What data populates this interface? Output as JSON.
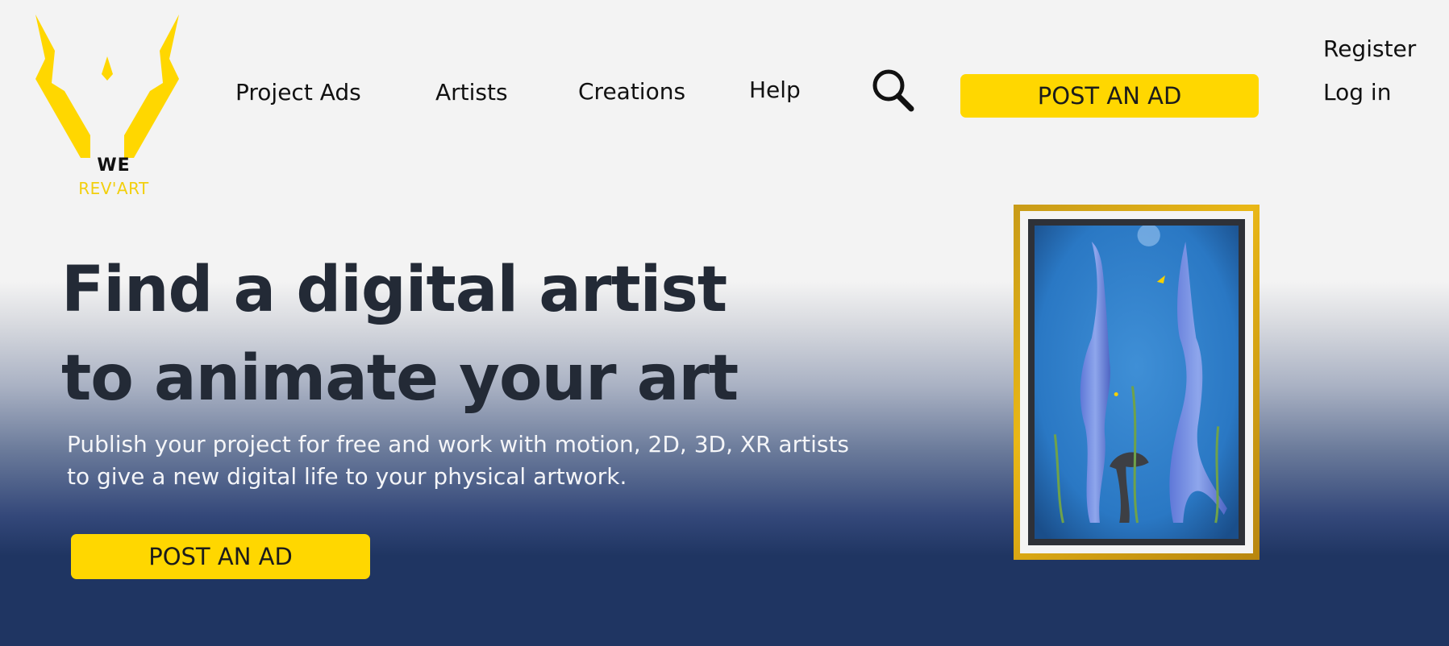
{
  "logo": {
    "we": "WE",
    "revart": "REV'ART",
    "brand_color": "#ffd700"
  },
  "nav": {
    "items": [
      {
        "label": "Project Ads"
      },
      {
        "label": "Artists"
      },
      {
        "label": "Creations"
      },
      {
        "label": "Help"
      }
    ],
    "search_icon": "search-icon",
    "post_ad_label": "POST AN AD",
    "register_label": "Register",
    "login_label": "Log in"
  },
  "hero": {
    "title_line1": "Find a digital artist",
    "title_line2": "to animate your art",
    "subtitle_line1": "Publish your project for free and work with motion, 2D, 3D, XR artists",
    "subtitle_line2": "to give a new digital life to your physical artwork.",
    "cta_label": "POST AN AD"
  },
  "artwork": {
    "description_icon": "framed-painting-image"
  },
  "colors": {
    "accent": "#ffd700",
    "dark_navy": "#1f3562",
    "title_text": "#232a36"
  }
}
